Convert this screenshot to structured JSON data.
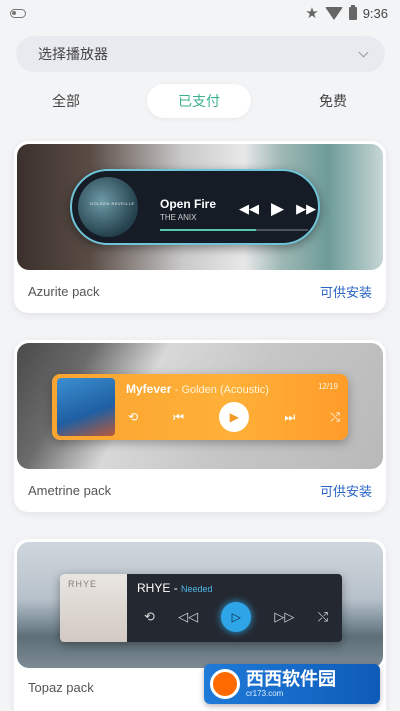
{
  "status": {
    "time": "9:36"
  },
  "selector": {
    "label": "选择播放器"
  },
  "tabs": [
    {
      "label": "全部"
    },
    {
      "label": "已支付",
      "active": true
    },
    {
      "label": "免费"
    }
  ],
  "cards": [
    {
      "name": "Azurite pack",
      "action": "可供安装",
      "widget": {
        "title": "Open Fire",
        "artist": "THE ANIX",
        "art_text": "GOLDEN REVEILLE",
        "progress": 0.65,
        "accent": "#56c9a8"
      }
    },
    {
      "name": "Ametrine pack",
      "action": "可供安装",
      "widget": {
        "title": "Myfever",
        "subtitle": "Golden (Acoustic)",
        "count": "12/19",
        "accent": "#f8a431"
      }
    },
    {
      "name": "Topaz pack",
      "action": "",
      "widget": {
        "title": "RHYE",
        "subtitle": "Needed",
        "art_text": "RHYE",
        "accent": "#2ea5e6"
      }
    }
  ],
  "watermark": {
    "main": "西西软件园",
    "sub": "cr173.com"
  },
  "colors": {
    "tab_active": "#3bb08f",
    "link": "#2a66c4"
  }
}
